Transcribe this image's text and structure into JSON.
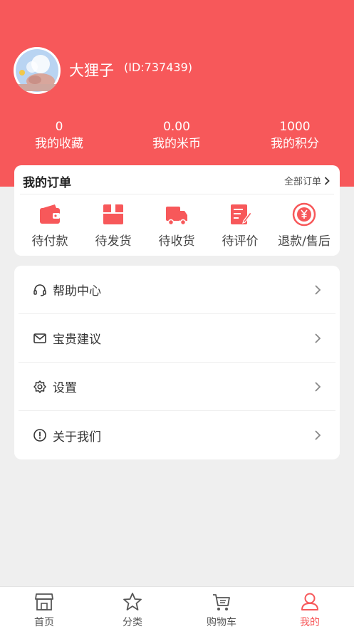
{
  "profile": {
    "name": "大狸子",
    "id_text": "(ID:737439)"
  },
  "stats": [
    {
      "value": "0",
      "label": "我的收藏"
    },
    {
      "value": "0.00",
      "label": "我的米币"
    },
    {
      "value": "1000",
      "label": "我的积分"
    }
  ],
  "orders": {
    "title": "我的订单",
    "all_link": "全部订单",
    "items": [
      {
        "label": "待付款",
        "icon": "wallet-icon"
      },
      {
        "label": "待发货",
        "icon": "package-icon"
      },
      {
        "label": "待收货",
        "icon": "truck-icon"
      },
      {
        "label": "待评价",
        "icon": "review-icon"
      },
      {
        "label": "退款/售后",
        "icon": "refund-icon"
      }
    ]
  },
  "menu": [
    {
      "label": "帮助中心",
      "icon": "headset-icon"
    },
    {
      "label": "宝贵建议",
      "icon": "mail-icon"
    },
    {
      "label": "设置",
      "icon": "settings-icon"
    },
    {
      "label": "关于我们",
      "icon": "info-icon"
    }
  ],
  "tabs": [
    {
      "label": "首页",
      "icon": "store-icon"
    },
    {
      "label": "分类",
      "icon": "star-icon"
    },
    {
      "label": "购物车",
      "icon": "cart-icon"
    },
    {
      "label": "我的",
      "icon": "user-icon",
      "active": true
    }
  ],
  "colors": {
    "accent": "#f7585a",
    "background": "#efefef"
  }
}
